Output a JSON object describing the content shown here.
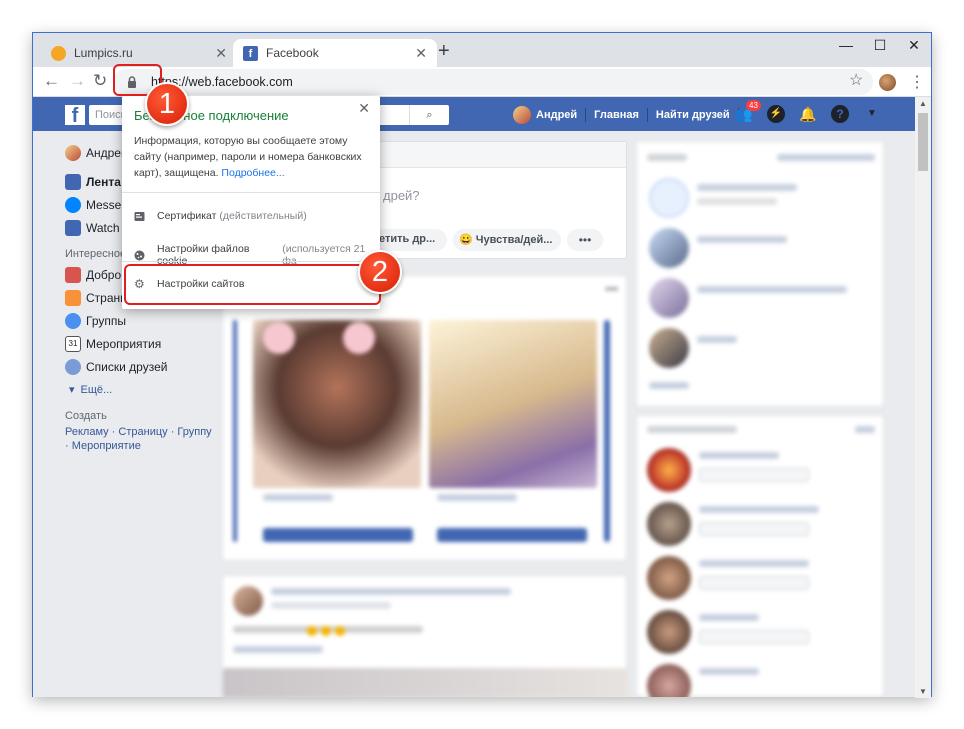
{
  "tabs": [
    {
      "title": "Lumpics.ru",
      "favicon_color": "#f5a623"
    },
    {
      "title": "Facebook",
      "favicon_color": "#4267b2"
    }
  ],
  "url": "https://web.facebook.com",
  "url_visible": "https://web.facebook.com",
  "facebook": {
    "search_placeholder": "Поиск",
    "user_name": "Андрей",
    "nav_home": "Главная",
    "nav_find_friends": "Найти друзей",
    "notification_count": "43"
  },
  "left_nav": {
    "profile": "Андрей",
    "items": [
      "Лента",
      "Messenger",
      "Watch"
    ],
    "interests_heading": "Интересное",
    "interest_items": [
      "Добро",
      "Страницы",
      "Группы",
      "Мероприятия",
      "Списки друзей",
      "Ещё..."
    ],
    "create_heading": "Создать",
    "create_links": "Рекламу · Страницу · Группу · Мероприятие"
  },
  "composer": {
    "placeholder": "дрей?",
    "btn_tag": "етить др...",
    "btn_feeling": "Чувства/дей..."
  },
  "site_info_popup": {
    "title": "Безопасное подключение",
    "description": "Информация, которую вы сообщаете этому сайту (например, пароли и номера банковских карт), защищена.",
    "more_link": "Подробнее...",
    "certificate_label": "Сертификат",
    "certificate_status": "(действительный)",
    "cookies_label": "Настройки файлов cookie",
    "cookies_note": "(используется 21 фа",
    "site_settings_label": "Настройки сайтов"
  },
  "callouts": [
    "1",
    "2"
  ],
  "accent_colors": {
    "facebook_blue": "#4267b2",
    "highlight_red": "#e02020",
    "secure_green": "#188038"
  }
}
